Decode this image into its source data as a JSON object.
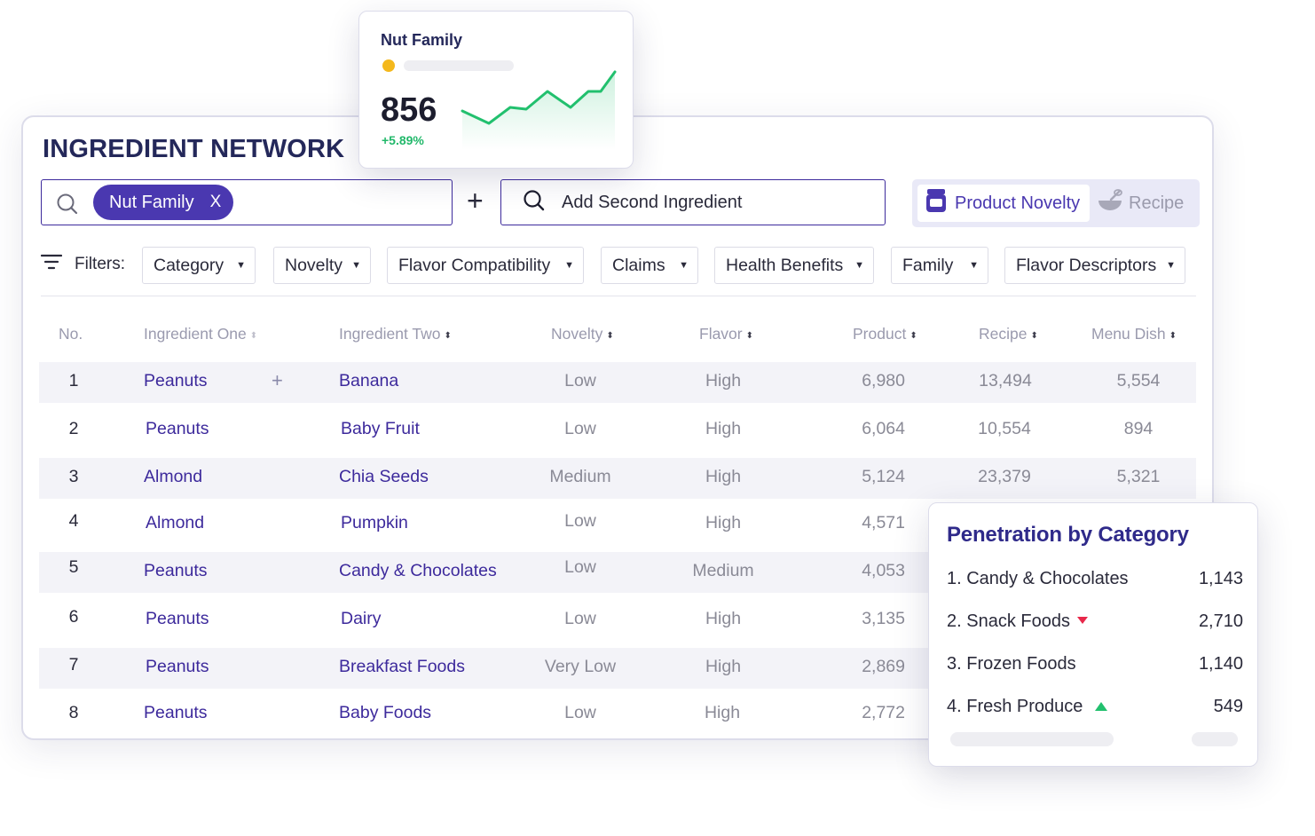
{
  "title": "INGREDIENT NETWORK",
  "search": {
    "chip_label": "Nut Family",
    "chip_remove": "X"
  },
  "plus": "+",
  "second_ingredient": {
    "label": "Add Second Ingredient"
  },
  "toggle": {
    "active": "Product Novelty",
    "inactive": "Recipe"
  },
  "filters": {
    "label": "Filters:",
    "buttons": [
      "Category",
      "Novelty",
      "Flavor Compatibility",
      "Claims",
      "Health Benefits",
      "Family",
      "Flavor Descriptors"
    ]
  },
  "table": {
    "headers": {
      "no": "No.",
      "one": "Ingredient One",
      "two": "Ingredient Two",
      "novelty": "Novelty",
      "flavor": "Flavor",
      "product": "Product",
      "recipe": "Recipe",
      "menu": "Menu Dish"
    },
    "rows": [
      {
        "no": "1",
        "one": "Peanuts",
        "two": "Banana",
        "novelty": "Low",
        "flavor": "High",
        "product": "6,980",
        "recipe": "13,494",
        "menu": "5,554"
      },
      {
        "no": "2",
        "one": "Peanuts",
        "two": "Baby Fruit",
        "novelty": "Low",
        "flavor": "High",
        "product": "6,064",
        "recipe": "10,554",
        "menu": "894"
      },
      {
        "no": "3",
        "one": "Almond",
        "two": "Chia Seeds",
        "novelty": "Medium",
        "flavor": "High",
        "product": "5,124",
        "recipe": "23,379",
        "menu": "5,321"
      },
      {
        "no": "4",
        "one": "Almond",
        "two": "Pumpkin",
        "novelty": "Low",
        "flavor": "High",
        "product": "4,571",
        "recipe": "",
        "menu": ""
      },
      {
        "no": "5",
        "one": "Peanuts",
        "two": "Candy & Chocolates",
        "novelty": "Low",
        "flavor": "Medium",
        "product": "4,053",
        "recipe": "",
        "menu": ""
      },
      {
        "no": "6",
        "one": "Peanuts",
        "two": "Dairy",
        "novelty": "Low",
        "flavor": "High",
        "product": "3,135",
        "recipe": "",
        "menu": ""
      },
      {
        "no": "7",
        "one": "Peanuts",
        "two": "Breakfast Foods",
        "novelty": "Very Low",
        "flavor": "High",
        "product": "2,869",
        "recipe": "",
        "menu": ""
      },
      {
        "no": "8",
        "one": "Peanuts",
        "two": "Baby Foods",
        "novelty": "Low",
        "flavor": "High",
        "product": "2,772",
        "recipe": "",
        "menu": ""
      }
    ]
  },
  "nut_card": {
    "title": "Nut Family",
    "value": "856",
    "change": "+5.89%"
  },
  "penetration": {
    "title": "Penetration by Category",
    "items": [
      {
        "label": "1. Candy & Chocolates",
        "value": "1,143",
        "trend": "none"
      },
      {
        "label": "2. Snack Foods",
        "value": "2,710",
        "trend": "down"
      },
      {
        "label": "3. Frozen Foods",
        "value": "1,140",
        "trend": "none"
      },
      {
        "label": "4. Fresh Produce",
        "value": "549",
        "trend": "up"
      }
    ]
  },
  "colors": {
    "brand": "#4a38b0",
    "title": "#24285a",
    "up": "#22c06e",
    "down": "#e8284a",
    "accent_dot": "#f4b81c"
  },
  "icons": [
    "search-icon",
    "close-icon",
    "jar-icon",
    "bowl-whisk-icon",
    "filter-icon",
    "caret-down-icon",
    "sort-icon",
    "plus-icon",
    "sparkline"
  ]
}
